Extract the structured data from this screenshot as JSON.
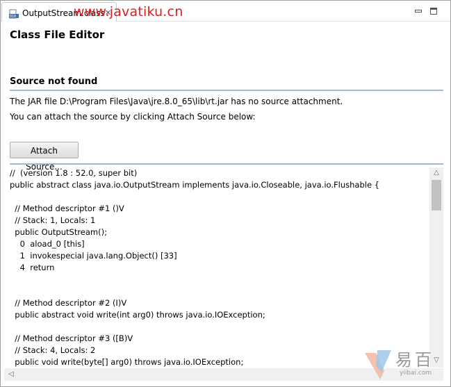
{
  "tab": {
    "label": "OutputStream.class",
    "close_glyph": "✕",
    "icon": "class-file-icon"
  },
  "watermark": "www.javatiku.cn",
  "window_buttons": {
    "minimize": "minimize-icon",
    "maximize": "maximize-icon"
  },
  "editor": {
    "title": "Class File Editor",
    "section_title": "Source not found",
    "info_line1": "The JAR file D:\\Program Files\\Java\\jre.8.0_65\\lib\\rt.jar has no source attachment.",
    "info_line2": "You can attach the source by clicking Attach Source below:",
    "attach_button": "Attach Source..."
  },
  "code": {
    "lines": [
      "//  (version 1.8 : 52.0, super bit)",
      "public abstract class java.io.OutputStream implements java.io.Closeable, java.io.Flushable {",
      "",
      "  // Method descriptor #1 ()V",
      "  // Stack: 1, Locals: 1",
      "  public OutputStream();",
      "    0  aload_0 [this]",
      "    1  invokespecial java.lang.Object() [33]",
      "    4  return",
      "",
      "",
      "  // Method descriptor #2 (I)V",
      "  public abstract void write(int arg0) throws java.io.IOException;",
      "",
      "  // Method descriptor #3 ([B)V",
      "  // Stack: 4, Locals: 2",
      "  public void write(byte[] arg0) throws java.io.IOException;"
    ]
  },
  "brand": {
    "name": "易百",
    "url": "yiibai.com"
  },
  "colors": {
    "watermark": "#d9201f",
    "separator": "#a7b7cb"
  }
}
